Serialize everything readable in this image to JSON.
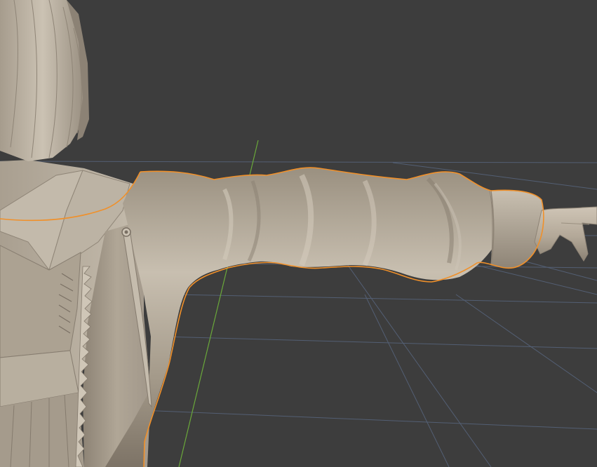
{
  "viewport": {
    "background_color": "#3d3d3d",
    "grid_line_color": "#56637a",
    "y_axis_color": "#6aa83a",
    "selection_outline_color": "#f0902a",
    "model_base_color": "#b5aa9b",
    "model_shadow_color": "#7e7468",
    "model_highlight_color": "#d6cdbf"
  },
  "selection": {
    "selected_object": "sleeve",
    "outline_visible": true
  },
  "icons": [
    "origin-point-icon"
  ]
}
